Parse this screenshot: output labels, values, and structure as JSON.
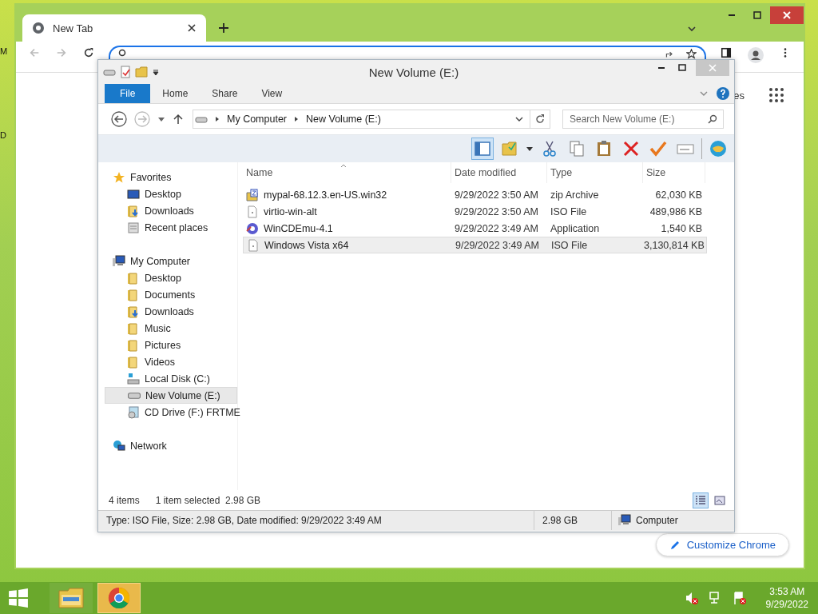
{
  "desktop_labels": [
    "M",
    "D"
  ],
  "browser": {
    "tabs": [
      {
        "title": "New Tab",
        "selected": true
      }
    ],
    "shortcut_text": "es",
    "customize_button": "Customize Chrome"
  },
  "explorer": {
    "title": "New Volume (E:)",
    "ribbon_tabs": [
      {
        "label": "File",
        "kind": "file",
        "selected": false
      },
      {
        "label": "Home",
        "kind": "tab",
        "selected": false
      },
      {
        "label": "Share",
        "kind": "tab",
        "selected": false
      },
      {
        "label": "View",
        "kind": "tab",
        "selected": false
      }
    ],
    "address": {
      "crumbs": [
        "My Computer",
        "New Volume (E:)"
      ]
    },
    "search": {
      "placeholder": "Search New Volume (E:)"
    },
    "nav_pane": [
      {
        "label": "Favorites",
        "kind": "star",
        "selected": false,
        "children": [
          {
            "label": "Desktop",
            "kind": "desktop",
            "selected": false
          },
          {
            "label": "Downloads",
            "kind": "downloads",
            "selected": false
          },
          {
            "label": "Recent places",
            "kind": "recent",
            "selected": false
          }
        ]
      },
      {
        "label": "My Computer",
        "kind": "computer",
        "selected": false,
        "children": [
          {
            "label": "Desktop",
            "kind": "folder",
            "selected": false
          },
          {
            "label": "Documents",
            "kind": "folder",
            "selected": false
          },
          {
            "label": "Downloads",
            "kind": "downloads",
            "selected": false
          },
          {
            "label": "Music",
            "kind": "folder",
            "selected": false
          },
          {
            "label": "Pictures",
            "kind": "folder",
            "selected": false
          },
          {
            "label": "Videos",
            "kind": "folder",
            "selected": false
          },
          {
            "label": "Local Disk (C:)",
            "kind": "disk",
            "selected": false
          },
          {
            "label": "New Volume (E:)",
            "kind": "drive",
            "selected": true
          },
          {
            "label": "CD Drive (F:) FRTME",
            "kind": "cd",
            "selected": false
          }
        ]
      },
      {
        "label": "Network",
        "kind": "network",
        "selected": false
      }
    ],
    "columns": [
      "Name",
      "Date modified",
      "Type",
      "Size"
    ],
    "files": [
      {
        "name": "mypal-68.12.3.en-US.win32",
        "date": "9/29/2022 3:50 AM",
        "type": "zip Archive",
        "size": "62,030 KB",
        "kind": "zip",
        "selected": false
      },
      {
        "name": "virtio-win-alt",
        "date": "9/29/2022 3:50 AM",
        "type": "ISO File",
        "size": "489,986 KB",
        "kind": "iso",
        "selected": false
      },
      {
        "name": "WinCDEmu-4.1",
        "date": "9/29/2022 3:49 AM",
        "type": "Application",
        "size": "1,540 KB",
        "kind": "app",
        "selected": false
      },
      {
        "name": "Windows Vista x64",
        "date": "9/29/2022 3:49 AM",
        "type": "ISO File",
        "size": "3,130,814 KB",
        "kind": "iso",
        "selected": true
      }
    ],
    "status": {
      "count": "4 items",
      "selection": "1 item selected  2.98 GB"
    },
    "views": [
      {
        "kind": "details",
        "selected": true
      },
      {
        "kind": "tiles",
        "selected": false
      }
    ],
    "details": {
      "text": "Type: ISO File, Size: 2.98 GB, Date modified: 9/29/2022 3:49 AM",
      "size": "2.98 GB",
      "location": "Computer"
    }
  },
  "taskbar": {
    "apps": [
      {
        "kind": "explorer",
        "active": false
      },
      {
        "kind": "chrome",
        "active": true
      }
    ],
    "time": "3:53 AM",
    "date": "9/29/2022"
  }
}
